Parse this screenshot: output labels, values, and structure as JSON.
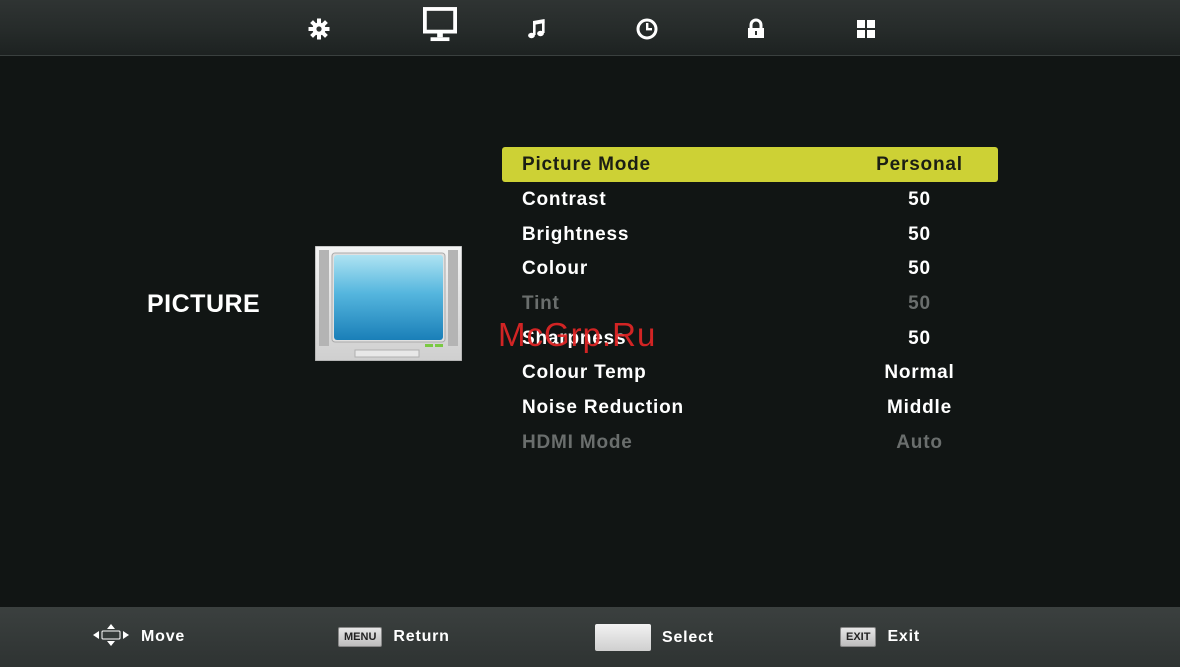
{
  "tabs": [
    {
      "name": "setup",
      "icon": "gear-icon"
    },
    {
      "name": "picture",
      "icon": "monitor-icon",
      "active": true
    },
    {
      "name": "sound",
      "icon": "music-note-icon"
    },
    {
      "name": "time",
      "icon": "clock-icon"
    },
    {
      "name": "lock",
      "icon": "lock-icon"
    },
    {
      "name": "channel",
      "icon": "grid-icon"
    }
  ],
  "section": {
    "title": "PICTURE"
  },
  "menu": {
    "items": [
      {
        "label": "Picture Mode",
        "value": "Personal",
        "state": "selected"
      },
      {
        "label": "Contrast",
        "value": "50",
        "state": "normal"
      },
      {
        "label": "Brightness",
        "value": "50",
        "state": "normal"
      },
      {
        "label": "Colour",
        "value": "50",
        "state": "normal"
      },
      {
        "label": "Tint",
        "value": "50",
        "state": "disabled"
      },
      {
        "label": "Sharpness",
        "value": "50",
        "state": "normal"
      },
      {
        "label": "Colour Temp",
        "value": "Normal",
        "state": "normal"
      },
      {
        "label": "Noise Reduction",
        "value": "Middle",
        "state": "normal"
      },
      {
        "label": "HDMI Mode",
        "value": "Auto",
        "state": "disabled"
      }
    ]
  },
  "watermark": "McGrp.Ru",
  "footer": {
    "move_label": "Move",
    "menu_key": "MENU",
    "return_label": "Return",
    "select_label": "Select",
    "exit_key": "EXIT",
    "exit_label": "Exit"
  },
  "colors": {
    "selection": "#cdd135",
    "background": "#111514",
    "disabled_text": "#6a6e6d"
  }
}
